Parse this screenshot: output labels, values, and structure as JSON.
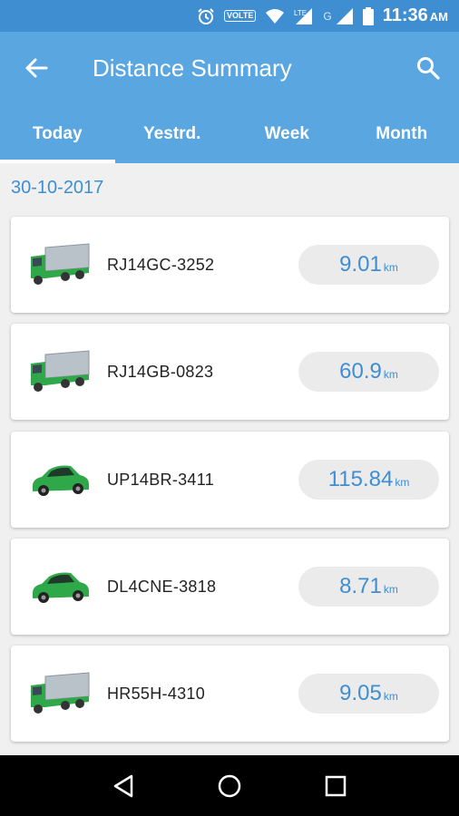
{
  "status_bar": {
    "volte": "VOLTE",
    "network_label": "LTE",
    "g_label": "G",
    "time": "11:36",
    "ampm": "AM"
  },
  "header": {
    "title": "Distance Summary"
  },
  "tabs": [
    {
      "label": "Today",
      "active": true
    },
    {
      "label": "Yestrd.",
      "active": false
    },
    {
      "label": "Week",
      "active": false
    },
    {
      "label": "Month",
      "active": false
    }
  ],
  "date": "30-10-2017",
  "vehicles": [
    {
      "plate": "RJ14GC-3252",
      "distance": "9.01",
      "unit": "km",
      "icon": "truck-icon"
    },
    {
      "plate": "RJ14GB-0823",
      "distance": "60.9",
      "unit": "km",
      "icon": "truck-icon"
    },
    {
      "plate": "UP14BR-3411",
      "distance": "115.84",
      "unit": "km",
      "icon": "car-icon"
    },
    {
      "plate": "DL4CNE-3818",
      "distance": "8.71",
      "unit": "km",
      "icon": "car-icon"
    },
    {
      "plate": "HR55H-4310",
      "distance": "9.05",
      "unit": "km",
      "icon": "truck-icon"
    }
  ],
  "colors": {
    "status_bar": "#3f8ed2",
    "app_bar": "#5aa6e0",
    "accent_text": "#3f8ed2",
    "vehicle_green": "#2fa84a"
  }
}
